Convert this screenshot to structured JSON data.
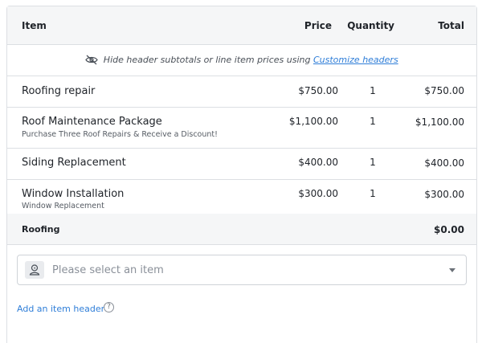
{
  "columns": {
    "item": "Item",
    "price": "Price",
    "quantity": "Quantity",
    "total": "Total"
  },
  "notice": {
    "icon": "eye-slash-icon",
    "text": "Hide header subtotals or line item prices using",
    "link_label": "Customize headers"
  },
  "line_items": [
    {
      "name": "Roofing repair",
      "description": "",
      "price": "$750.00",
      "quantity": "1",
      "total": "$750.00"
    },
    {
      "name": "Roof Maintenance Package",
      "description": "Purchase Three Roof Repairs & Receive a Discount!",
      "price": "$1,100.00",
      "quantity": "1",
      "total": "$1,100.00"
    },
    {
      "name": "Siding Replacement",
      "description": "",
      "price": "$400.00",
      "quantity": "1",
      "total": "$400.00"
    },
    {
      "name": "Window Installation",
      "description": "Window Replacement",
      "price": "$300.00",
      "quantity": "1",
      "total": "$300.00"
    }
  ],
  "subtotal": {
    "label": "Roofing",
    "value": "$0.00"
  },
  "item_select": {
    "icon": "item-icon",
    "placeholder": "Please select an item"
  },
  "add_header": {
    "label": "Add an item header",
    "help_icon": "question-circle-icon",
    "help_glyph": "?"
  },
  "colors": {
    "link": "#2f7ed8",
    "header_bg": "#f5f6f7",
    "border": "#dcdfe3"
  }
}
